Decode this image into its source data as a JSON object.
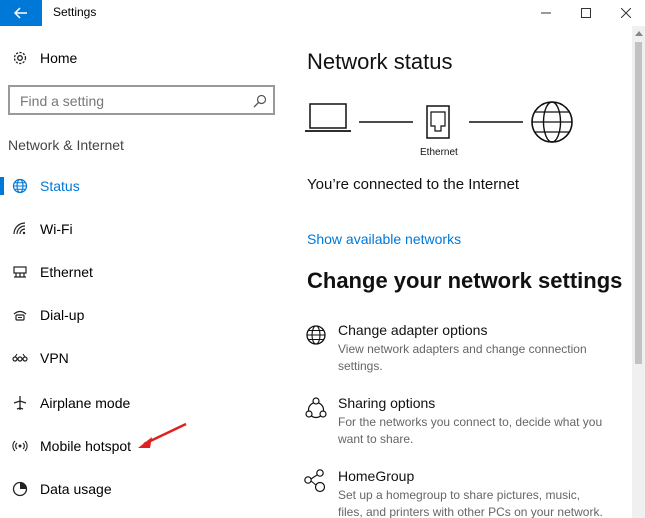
{
  "window": {
    "title": "Settings",
    "back_icon": "back-arrow-icon",
    "minimize_icon": "minimize-icon",
    "maximize_icon": "maximize-icon",
    "close_icon": "close-icon"
  },
  "sidebar": {
    "home_label": "Home",
    "search_placeholder": "Find a setting",
    "section_label": "Network & Internet",
    "items": [
      {
        "label": "Status",
        "icon": "globe-icon",
        "active": true
      },
      {
        "label": "Wi-Fi",
        "icon": "wifi-icon",
        "active": false
      },
      {
        "label": "Ethernet",
        "icon": "ethernet-icon",
        "active": false
      },
      {
        "label": "Dial-up",
        "icon": "dialup-icon",
        "active": false
      },
      {
        "label": "VPN",
        "icon": "vpn-icon",
        "active": false
      },
      {
        "label": "Airplane mode",
        "icon": "airplane-icon",
        "active": false
      },
      {
        "label": "Mobile hotspot",
        "icon": "hotspot-icon",
        "active": false
      },
      {
        "label": "Data usage",
        "icon": "data-usage-icon",
        "active": false
      }
    ]
  },
  "main": {
    "status_heading": "Network status",
    "ethernet_label": "Ethernet",
    "connected_text": "You’re connected to the Internet",
    "show_networks_link": "Show available networks",
    "change_heading": "Change your network settings",
    "options": [
      {
        "title": "Change adapter options",
        "desc": "View network adapters and change connection settings.",
        "icon": "adapter-icon"
      },
      {
        "title": "Sharing options",
        "desc": "For the networks you connect to, decide what you want to share.",
        "icon": "sharing-icon"
      },
      {
        "title": "HomeGroup",
        "desc": "Set up a homegroup to share pictures, music, files, and printers with other PCs on your network.",
        "icon": "homegroup-icon"
      }
    ]
  },
  "colors": {
    "accent": "#0078d7",
    "annotation_arrow": "#e02020"
  }
}
